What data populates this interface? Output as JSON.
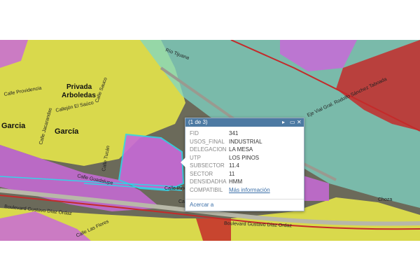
{
  "map": {
    "places": {
      "privada": "Privada",
      "arboledas": "Arboledas",
      "garcia_1": "Garcia",
      "garcia_2": "García"
    },
    "streets": {
      "calle_providencia": "Calle Providencia",
      "calle_de_la_salle": "Callejón El Saúco",
      "calle_sauce": "Calle Sauco",
      "calle_jacarandas": "Calle Jacarandas",
      "calle_tucan": "Calle Tucán",
      "calle_guadalupe": "Calle Guadalupe",
      "calle_pinos": "Calle Pinos",
      "calle_jeca": "Calle Jeca",
      "blvd_diaz_ordaz_1": "Boulevard Gustavo Díaz Ordaz",
      "blvd_diaz_ordaz_2": "Boulevard Gustavo Díaz Ordaz",
      "calle_las_flores": "Calle Las Flores",
      "eje_vial": "Eje Vial Gral. Rodolfo Sánchez Taboada",
      "choza": "Choza",
      "rio_tijuana": "Río Tijuana"
    },
    "colors": {
      "industrial": "#7fd6c6",
      "habitacional": "#e8e84a",
      "comercial": "#c86ad8",
      "equipamiento": "#c42a2a",
      "selection": "#34d3e8"
    }
  },
  "popup": {
    "counter": "(1 de 3)",
    "next_icon": "▸",
    "maximize_icon": "▭",
    "close_icon": "✕",
    "rows": [
      {
        "key": "FID",
        "value": "341"
      },
      {
        "key": "USOS_FINAL",
        "value": "INDUSTRIAL"
      },
      {
        "key": "DELEGACION",
        "value": "LA MESA"
      },
      {
        "key": "UTP",
        "value": "LOS PINOS"
      },
      {
        "key": "SUBSECTOR",
        "value": "11.4"
      },
      {
        "key": "SECTOR",
        "value": "11"
      },
      {
        "key": "DENSIDADHA",
        "value": "HMM"
      },
      {
        "key": "COMPATIBIL",
        "value": "Más información"
      }
    ],
    "zoom_label": "Acercar a"
  }
}
